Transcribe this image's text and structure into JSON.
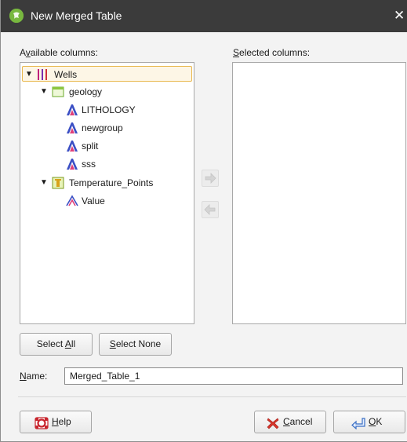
{
  "window": {
    "title": "New Merged Table",
    "close_glyph": "✕"
  },
  "available": {
    "label_prefix": "A",
    "label_accel": "v",
    "label_rest": "ailable columns:",
    "tree": {
      "wells": {
        "label": "Wells",
        "icon": "wells-icon"
      },
      "geology": {
        "label": "geology",
        "icon": "table-icon",
        "children": [
          {
            "label": "LITHOLOGY",
            "icon": "category-column-icon"
          },
          {
            "label": "newgroup",
            "icon": "category-column-icon"
          },
          {
            "label": "split",
            "icon": "category-column-icon"
          },
          {
            "label": "sss",
            "icon": "category-column-icon"
          }
        ]
      },
      "temperature_points": {
        "label": "Temperature_Points",
        "icon": "points-table-icon",
        "children": [
          {
            "label": "Value",
            "icon": "numeric-column-icon"
          }
        ]
      }
    }
  },
  "selected": {
    "label_accel": "S",
    "label_rest": "elected columns:"
  },
  "buttons": {
    "select_all": {
      "pre": "Select ",
      "accel": "A",
      "post": "ll"
    },
    "select_none": {
      "pre": "",
      "accel": "S",
      "post": "elect None"
    },
    "help": {
      "pre": "",
      "accel": "H",
      "post": "elp"
    },
    "cancel": {
      "pre": "",
      "accel": "C",
      "post": "ancel"
    },
    "ok": {
      "pre": "",
      "accel": "O",
      "post": "K"
    }
  },
  "name": {
    "label_accel": "N",
    "label_rest": "ame:",
    "value": "Merged_Table_1"
  },
  "colors": {
    "titlebar": "#3b3b3b",
    "selection_border": "#e8b84e",
    "selection_fill": "#fdf6e6",
    "app_icon": "#78b83f"
  }
}
